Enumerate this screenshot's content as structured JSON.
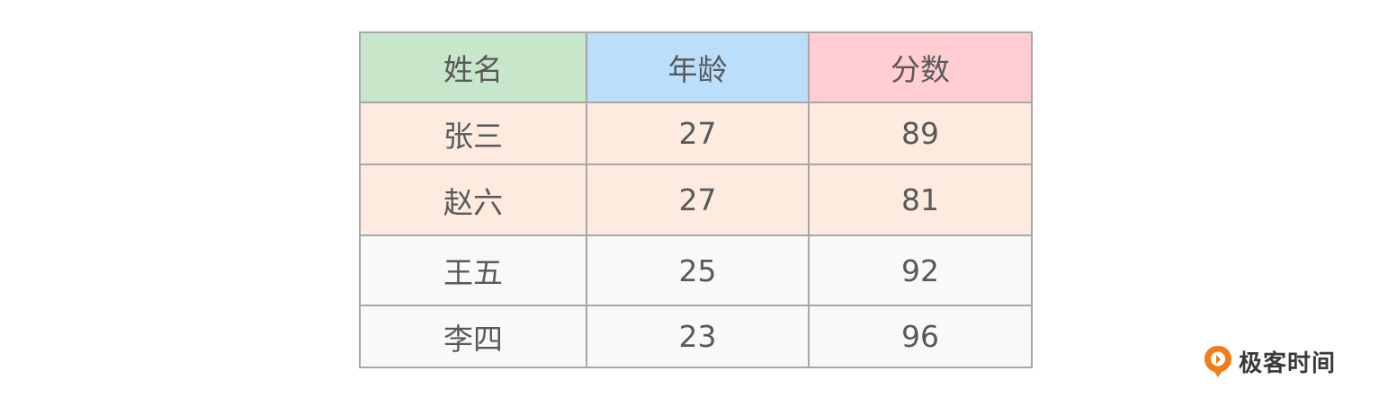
{
  "table": {
    "headers": [
      {
        "label": "姓名",
        "color": "#c8e6c9"
      },
      {
        "label": "年龄",
        "color": "#bbdefb"
      },
      {
        "label": "分数",
        "color": "#ffcdd2"
      }
    ],
    "rows": [
      {
        "cells": [
          "张三",
          "27",
          "89"
        ],
        "color": "#fdebe0"
      },
      {
        "cells": [
          "赵六",
          "27",
          "81"
        ],
        "color": "#fdebe0"
      },
      {
        "cells": [
          "王五",
          "25",
          "92"
        ],
        "color": "#f9f9f9"
      },
      {
        "cells": [
          "李四",
          "23",
          "96"
        ],
        "color": "#f9f9f9"
      }
    ],
    "border_color": "#a7a7a7",
    "text_color": "#595959"
  },
  "logo": {
    "text": "极客时间",
    "icon": "geektime-logo-icon",
    "accent_color": "#f07d1c"
  }
}
